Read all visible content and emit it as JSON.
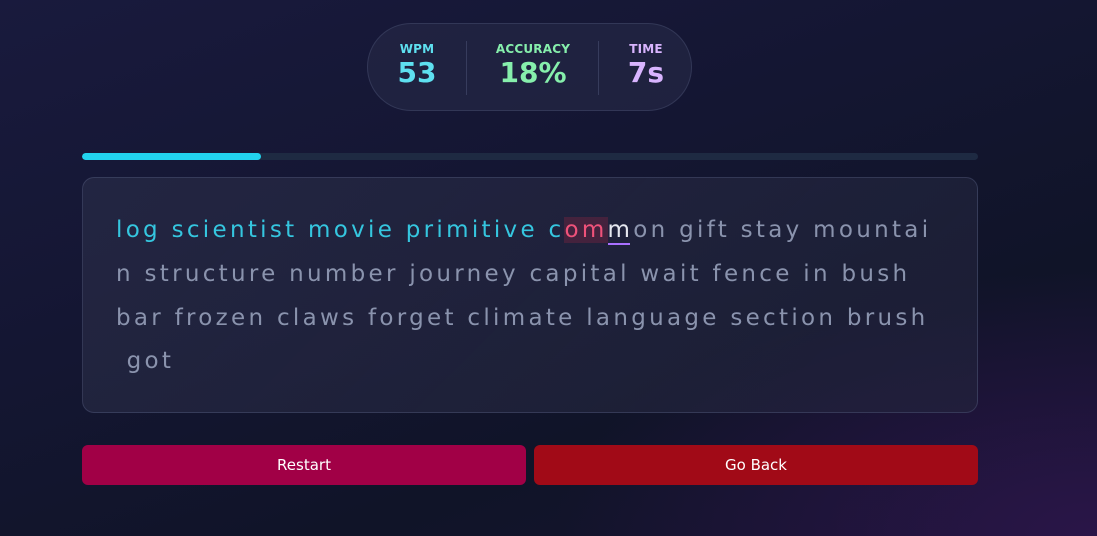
{
  "stats": {
    "wpm": {
      "label": "WPM",
      "value": "53",
      "color": "#5ee0f0"
    },
    "accuracy": {
      "label": "ACCURACY",
      "value": "18%",
      "color": "#86efac"
    },
    "time": {
      "label": "TIME",
      "value": "7s",
      "color": "#d8b4fe"
    }
  },
  "progress": {
    "fraction": 0.2
  },
  "typing": {
    "typed_text": "log scientist movie primitive c",
    "error_chars": [
      "o",
      "m"
    ],
    "current_char": "m",
    "line1_rest": "on gift stay mountai",
    "line2": "n structure number journey capital wait fence in bush",
    "line3": "bar frozen claws forget climate language section brush",
    "line4": " got"
  },
  "buttons": {
    "restart": "Restart",
    "go_back": "Go Back"
  },
  "colors": {
    "typed": "#35c6df",
    "error": "#f0527a",
    "pending": "#8a93ad",
    "cursor": "#a970ff",
    "progress": "#22d3ee",
    "restart_bg": "#a10046",
    "go_back_bg": "#a10a17"
  }
}
